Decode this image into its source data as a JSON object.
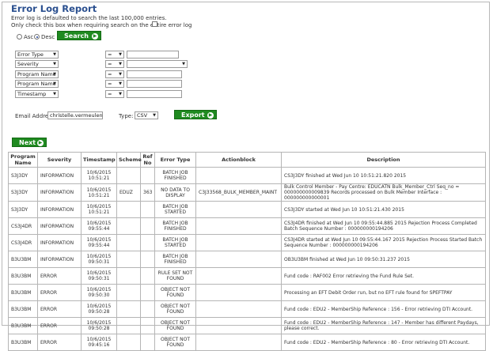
{
  "title": "Error Log Report",
  "note_default": "Error log is defaulted to search the last 100,000 entries.",
  "note_check": "Only check this box when requiring search on the entire error log",
  "sort": {
    "asc": "Asc",
    "desc": "Desc",
    "selected": "desc"
  },
  "search_label": "Search",
  "filters": [
    {
      "field": "Error Type",
      "op": "=",
      "value": ""
    },
    {
      "field": "Severity",
      "op": "=",
      "value": ""
    },
    {
      "field": "Program Name",
      "op": "=",
      "value": ""
    },
    {
      "field": "Program Name",
      "op": "=",
      "value": ""
    },
    {
      "field": "Timestamp",
      "op": "=",
      "value": ""
    }
  ],
  "email_label": "Email Address:",
  "email_value": "christelle.vermeulen@by",
  "type_label": "Type:",
  "type_value": "CSV",
  "export_label": "Export",
  "next_label": "Next",
  "table": {
    "headers": [
      "Program Name",
      "Severity",
      "Timestamp",
      "Scheme",
      "Ref No",
      "Error Type",
      "Actionblock",
      "Description"
    ],
    "rows": [
      [
        "S3J3DY",
        "INFORMATION",
        "10/6/2015 10:51:21",
        "",
        "",
        "BATCH JOB FINISHED",
        "",
        "CS3J3DY finished at Wed Jun 10 10:51:21.820 2015"
      ],
      [
        "S3J3DY",
        "INFORMATION",
        "10/6/2015 10:51:21",
        "EDUZ",
        "363",
        "NO DATA TO DISPLAY",
        "C3J33568_BULK_MEMBER_MAINT",
        "Bulk Control Member - Pay Centre: EDUCATN Bulk_Member_Ctrl Seq_no = 000000000009839 Records processed on Bulk Member Interface : 000000000000001"
      ],
      [
        "S3J3DY",
        "INFORMATION",
        "10/6/2015 10:51:21",
        "",
        "",
        "BATCH JOB STARTED",
        "",
        "CS3J3DY started at Wed Jun 10 10:51:21.430 2015"
      ],
      [
        "CS3J4DR",
        "INFORMATION",
        "10/6/2015 09:55:44",
        "",
        "",
        "BATCH JOB FINISHED",
        "",
        "CS3J4DR finished at Wed Jun 10 09:55:44.885 2015 Rejection Process Completed Batch Sequence Number : 000000000194206"
      ],
      [
        "CS3J4DR",
        "INFORMATION",
        "10/6/2015 09:55:44",
        "",
        "",
        "BATCH JOB STARTED",
        "",
        "CS3J4DR started at Wed Jun 10 09:55:44.167 2015 Rejection Process Started Batch Sequence Number : 000000000194206"
      ],
      [
        "B3U3BM",
        "INFORMATION",
        "10/6/2015 09:50:31",
        "",
        "",
        "BATCH JOB FINISHED",
        "",
        "OB3U3BM finished at Wed Jun 10 09:50:31.237 2015"
      ],
      [
        "B3U3BM",
        "ERROR",
        "10/6/2015 09:50:31",
        "",
        "",
        "RULE SET NOT FOUND",
        "",
        "Fund code : RAF002 Error retrieving the Fund Rule Set."
      ],
      [
        "B3U3BM",
        "ERROR",
        "10/6/2015 09:50:30",
        "",
        "",
        "OBJECT NOT FOUND",
        "",
        "Processing an EFT Debit Order run, but no EFT rule found for SPEFTPAY"
      ],
      [
        "B3U3BM",
        "ERROR",
        "10/6/2015 09:50:28",
        "",
        "",
        "OBJECT NOT FOUND",
        "",
        "Fund code : EDU2 - MemberShip Reference : 156 - Error retrieving DTI Account."
      ],
      [
        "B3U3BM",
        "ERROR",
        "10/6/2015 09:50:28",
        "",
        "",
        "OBJECT NOT FOUND",
        "",
        "Fund code : EDU2 - MemberShip Reference : 147 - Member has different Paydays, please correct."
      ],
      [
        "B3U3BM",
        "ERROR",
        "10/6/2015 09:45:16",
        "",
        "",
        "OBJECT NOT FOUND",
        "",
        "Fund code : EDU2 - MemberShip Reference : 80 - Error retrieving DTI Account."
      ]
    ]
  }
}
